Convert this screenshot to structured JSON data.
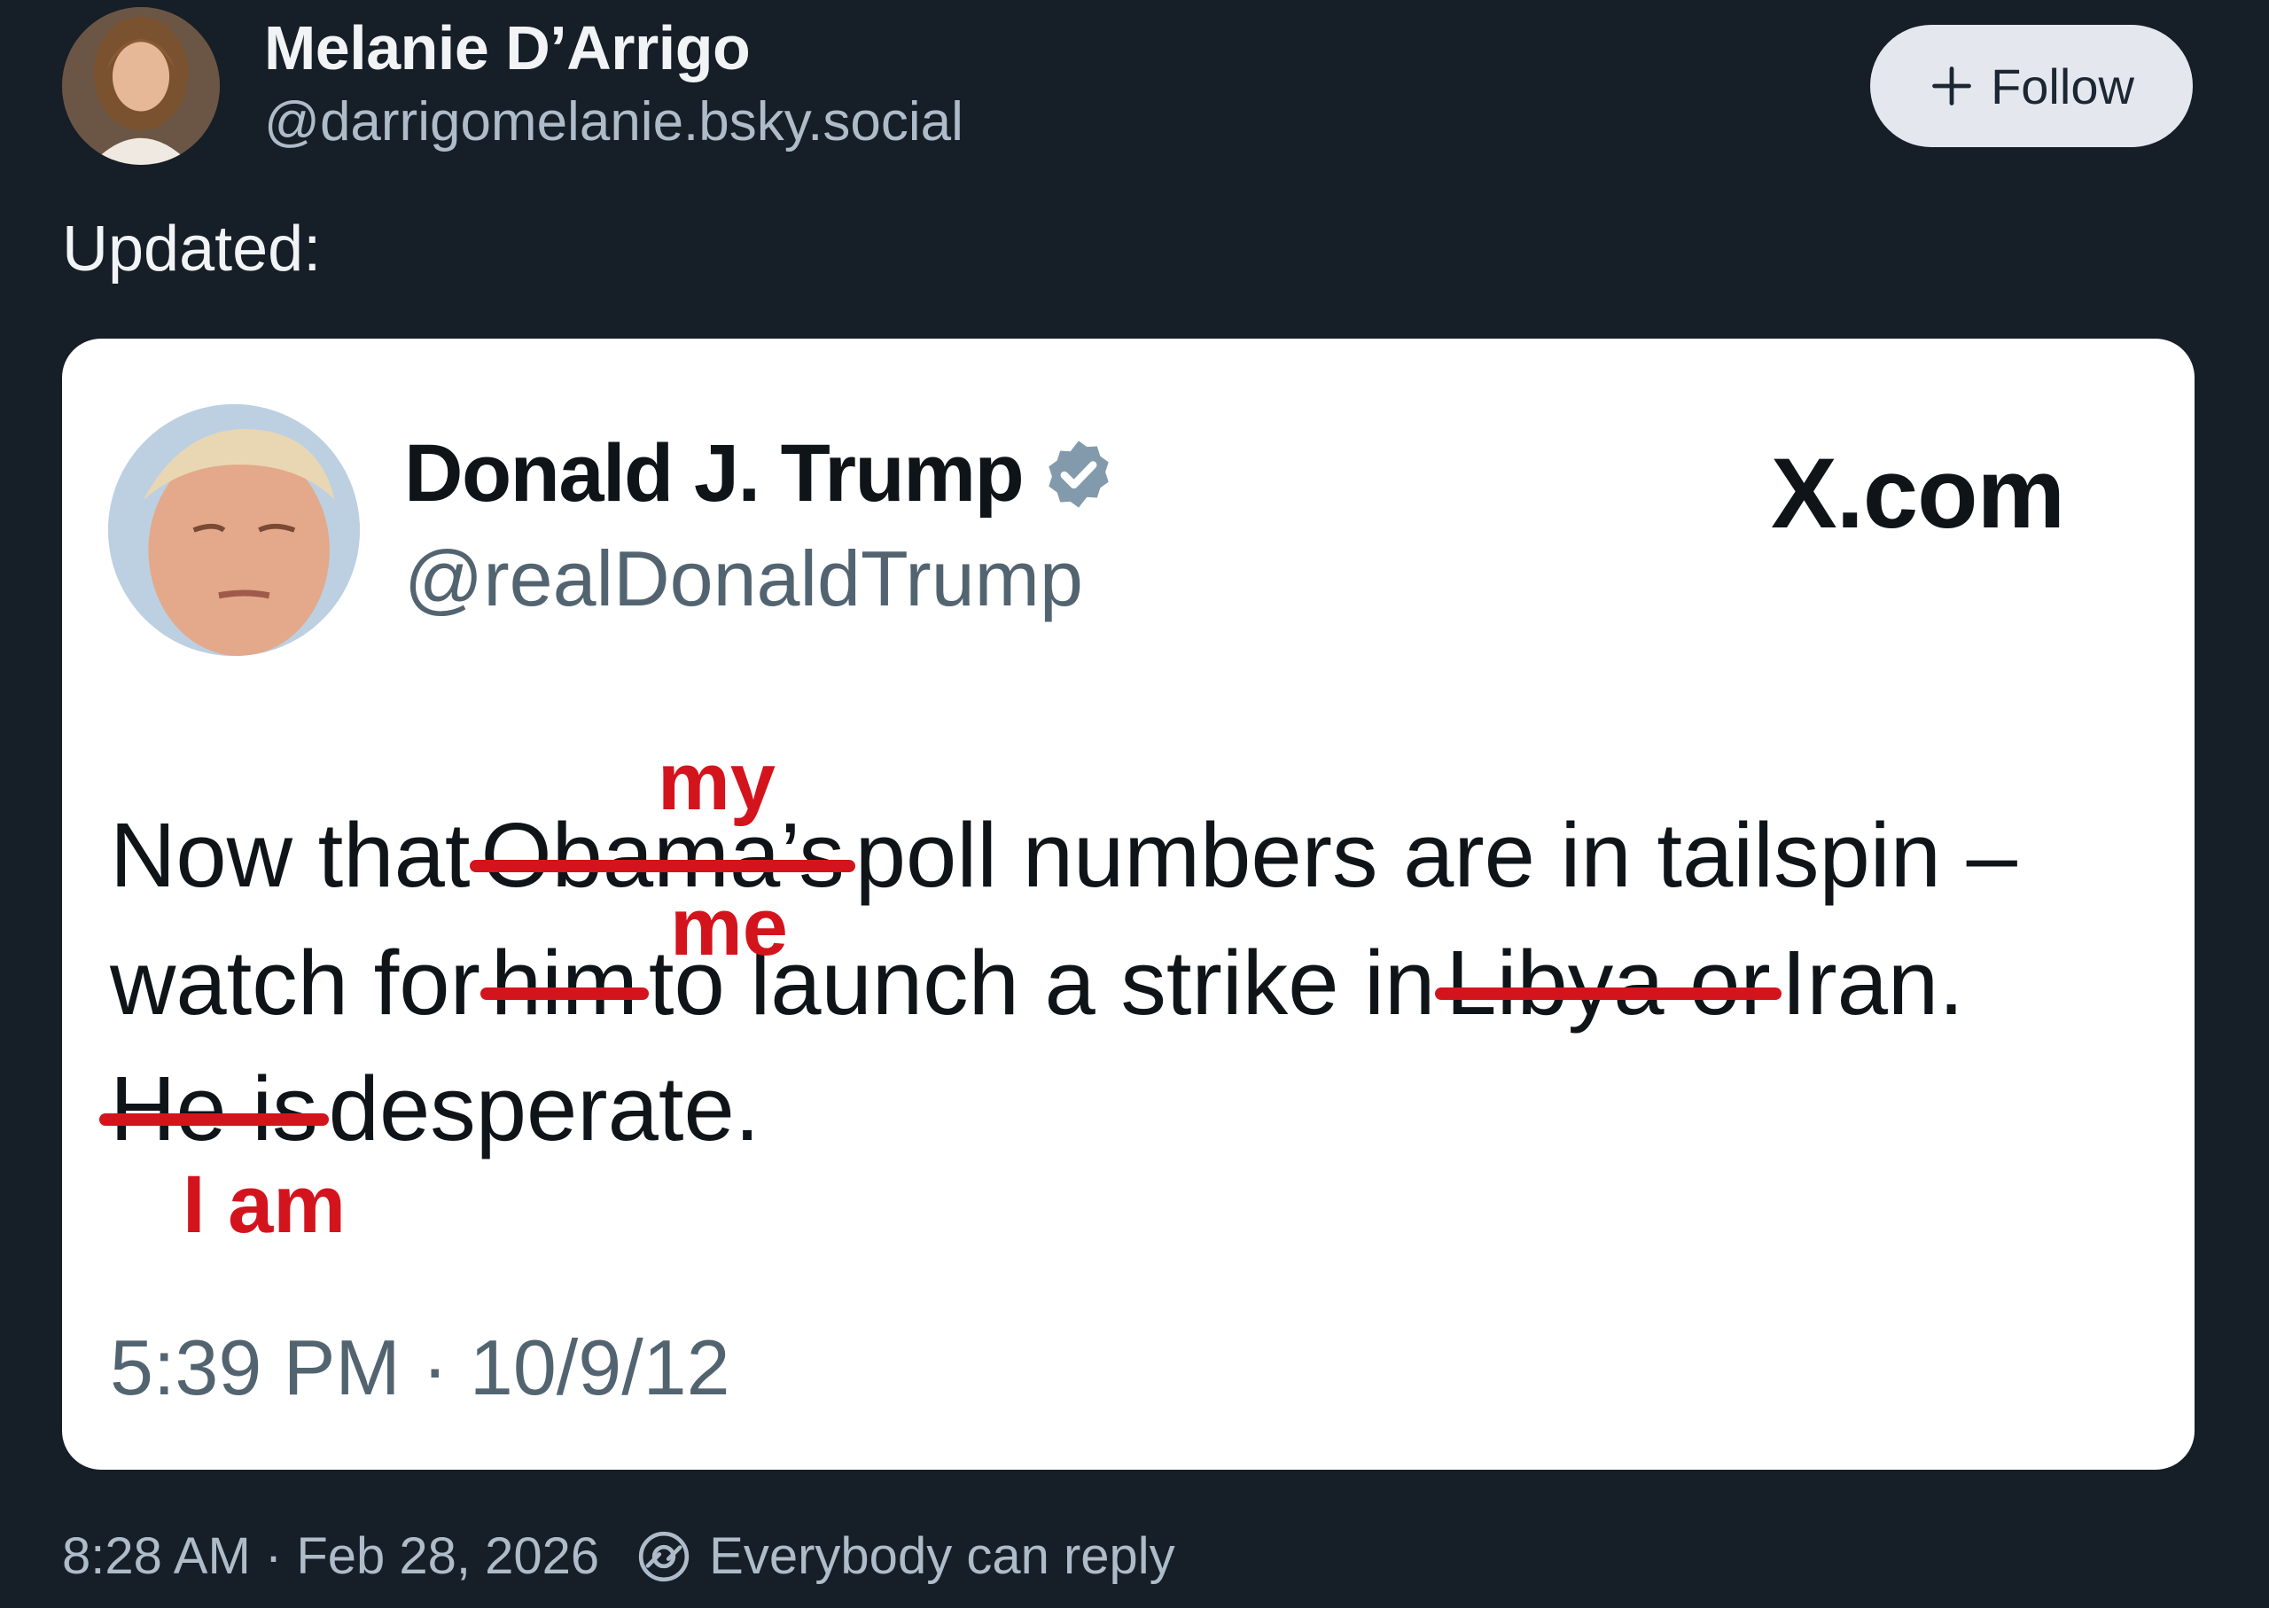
{
  "post": {
    "author": {
      "display_name": "Melanie D’Arrigo",
      "handle": "@darrigomelanie.bsky.social"
    },
    "follow_button": {
      "icon": "plus-icon",
      "label": "Follow"
    },
    "text": "Updated:",
    "timestamp": "8:28 AM · Feb 28, 2026",
    "reply_icon": "reply-settings-icon",
    "reply_setting": "Everybody can reply"
  },
  "embedded_image": {
    "author_name": "Donald J. Trump",
    "verified_icon": "verified-badge-icon",
    "author_handle": "@realDonaldTrump",
    "brand": "X.com",
    "lines": [
      {
        "pre": "Now that",
        "struck": "Obama’s",
        "post": "poll numbers are in tailspin –"
      },
      {
        "pre": "watch for",
        "struck": "him",
        "mid": "to launch a strike in",
        "struck2": "Libya or",
        "post": "Iran."
      },
      {
        "struck": "He is",
        "post": "desperate."
      }
    ],
    "corrections": {
      "my": "my",
      "me": "me",
      "i_am": "I am"
    },
    "timestamp": "5:39 PM · 10/9/12"
  },
  "colors": {
    "background": "#161e27",
    "card_background": "#ffffff",
    "correction_red": "#d4141d",
    "muted_text": "#aebbc9",
    "follow_button_bg": "#e4e8ee"
  }
}
